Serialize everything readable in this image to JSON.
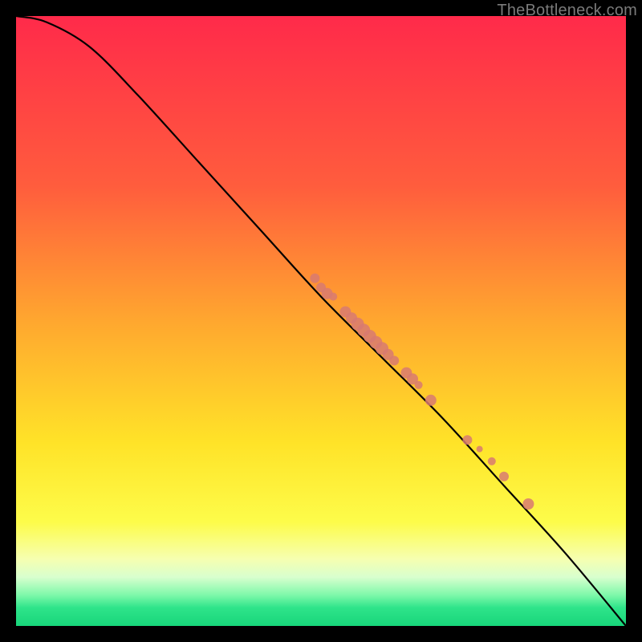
{
  "watermark": "TheBottleneck.com",
  "colors": {
    "frame": "#000000",
    "curve": "#000000",
    "dot": "#d87a71",
    "gradient_stops": [
      {
        "pct": 0,
        "color": "#ff2a4a"
      },
      {
        "pct": 28,
        "color": "#ff5d3d"
      },
      {
        "pct": 50,
        "color": "#ffa72f"
      },
      {
        "pct": 70,
        "color": "#ffe328"
      },
      {
        "pct": 83,
        "color": "#fdfc4a"
      },
      {
        "pct": 89,
        "color": "#f6ffb0"
      },
      {
        "pct": 92,
        "color": "#d8ffce"
      },
      {
        "pct": 95,
        "color": "#7cf8a9"
      },
      {
        "pct": 97,
        "color": "#2fe48a"
      },
      {
        "pct": 100,
        "color": "#17d57a"
      }
    ]
  },
  "chart_data": {
    "type": "line",
    "title": "",
    "xlabel": "",
    "ylabel": "",
    "xlim": [
      0,
      100
    ],
    "ylim": [
      0,
      100
    ],
    "series": [
      {
        "name": "curve",
        "points": [
          {
            "x": 0,
            "y": 100
          },
          {
            "x": 5,
            "y": 99
          },
          {
            "x": 12,
            "y": 95
          },
          {
            "x": 20,
            "y": 87
          },
          {
            "x": 30,
            "y": 76
          },
          {
            "x": 40,
            "y": 65
          },
          {
            "x": 50,
            "y": 54
          },
          {
            "x": 60,
            "y": 44
          },
          {
            "x": 70,
            "y": 34
          },
          {
            "x": 80,
            "y": 23
          },
          {
            "x": 90,
            "y": 12
          },
          {
            "x": 100,
            "y": 0
          }
        ]
      }
    ],
    "dots": [
      {
        "x": 49,
        "y": 57.0,
        "r": 6
      },
      {
        "x": 50,
        "y": 55.5,
        "r": 6
      },
      {
        "x": 51,
        "y": 54.5,
        "r": 7
      },
      {
        "x": 52,
        "y": 54.0,
        "r": 5
      },
      {
        "x": 54,
        "y": 51.5,
        "r": 7
      },
      {
        "x": 55,
        "y": 50.5,
        "r": 7
      },
      {
        "x": 56,
        "y": 49.5,
        "r": 8
      },
      {
        "x": 57,
        "y": 48.5,
        "r": 8
      },
      {
        "x": 58,
        "y": 47.5,
        "r": 8
      },
      {
        "x": 59,
        "y": 46.5,
        "r": 8
      },
      {
        "x": 60,
        "y": 45.5,
        "r": 8
      },
      {
        "x": 61,
        "y": 44.5,
        "r": 7
      },
      {
        "x": 62,
        "y": 43.5,
        "r": 6
      },
      {
        "x": 64,
        "y": 41.5,
        "r": 7
      },
      {
        "x": 65,
        "y": 40.5,
        "r": 7
      },
      {
        "x": 66,
        "y": 39.5,
        "r": 5
      },
      {
        "x": 68,
        "y": 37.0,
        "r": 7
      },
      {
        "x": 74,
        "y": 30.5,
        "r": 6
      },
      {
        "x": 76,
        "y": 29.0,
        "r": 4
      },
      {
        "x": 78,
        "y": 27.0,
        "r": 5
      },
      {
        "x": 80,
        "y": 24.5,
        "r": 6
      },
      {
        "x": 84,
        "y": 20.0,
        "r": 7
      }
    ]
  }
}
